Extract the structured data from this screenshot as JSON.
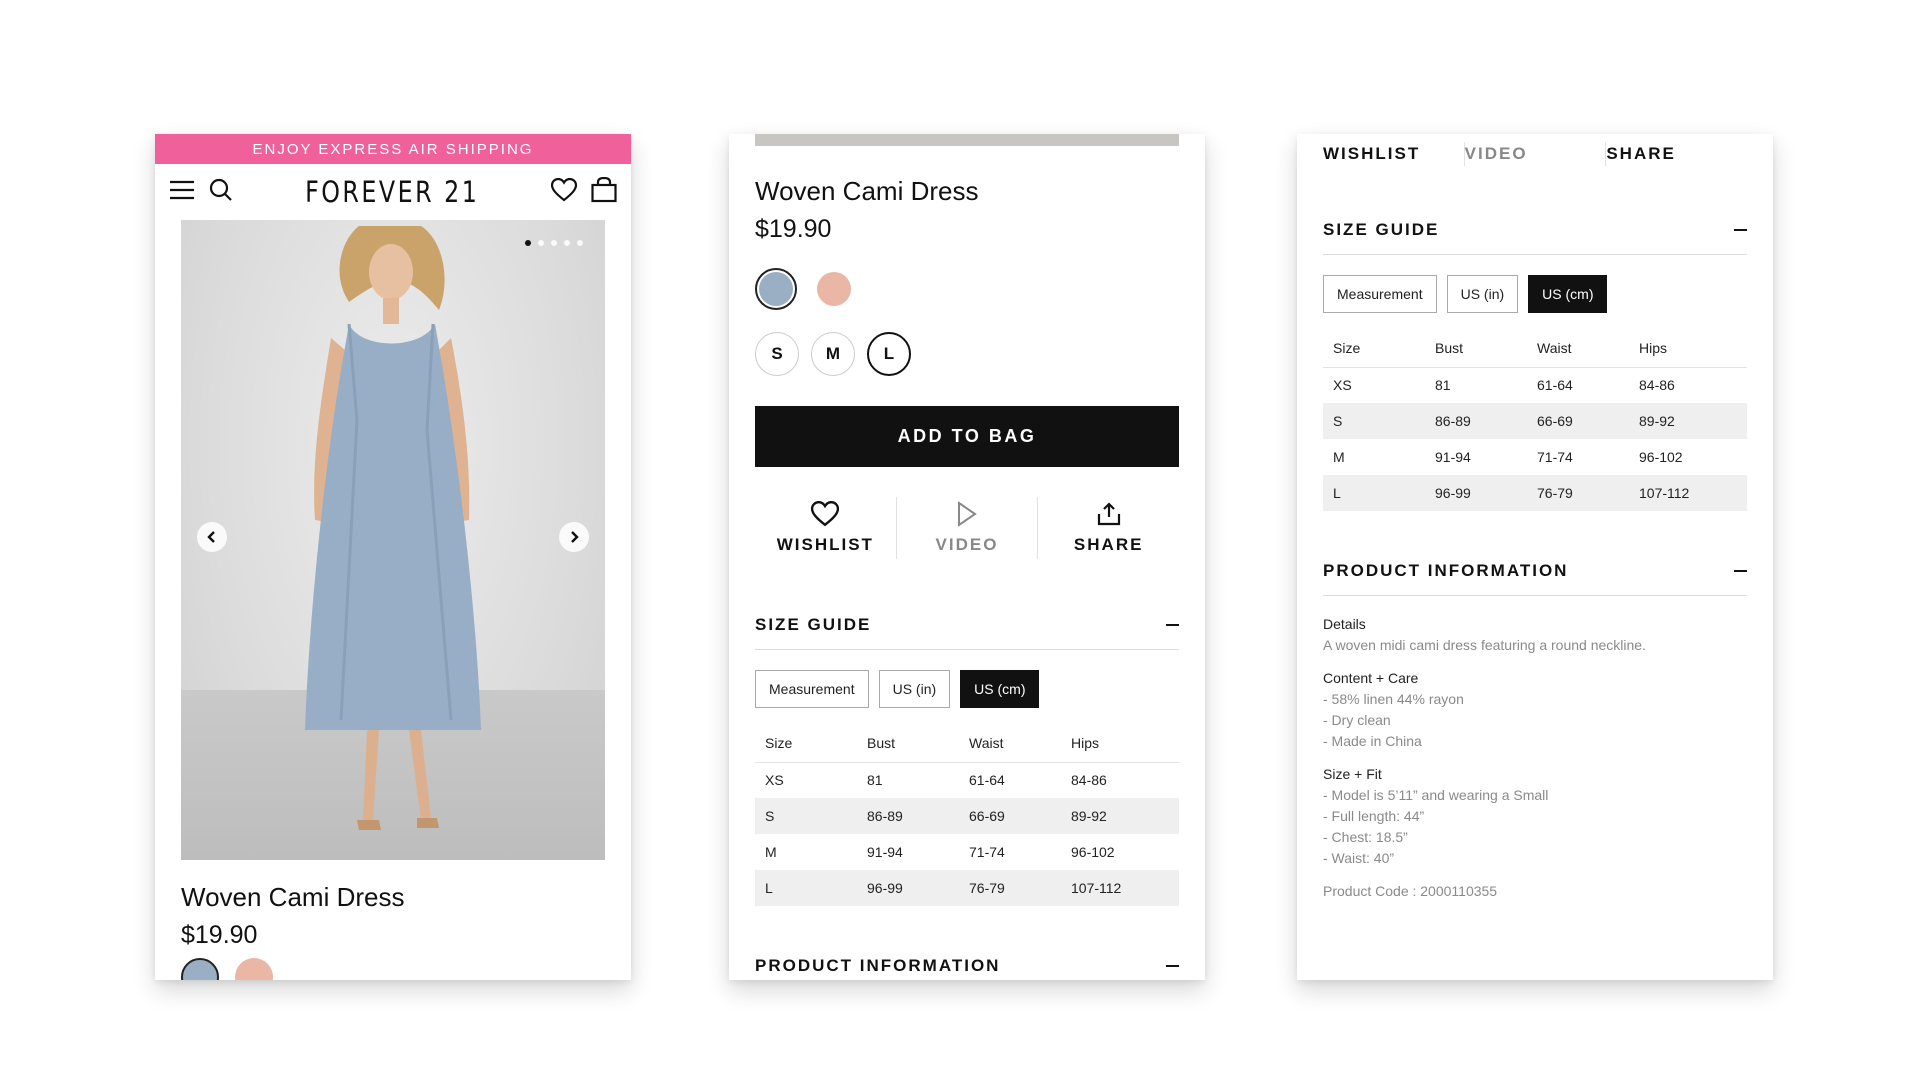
{
  "promo": "ENJOY EXPRESS AIR SHIPPING",
  "brand": "FOREVER 21",
  "product": {
    "name": "Woven Cami Dress",
    "price": "$19.90"
  },
  "colors": [
    "#9aaec4",
    "#eab6a6"
  ],
  "sizes": [
    "S",
    "M",
    "L"
  ],
  "add_to_bag": "ADD TO BAG",
  "actions": {
    "wishlist": "WISHLIST",
    "video": "VIDEO",
    "share": "SHARE"
  },
  "size_guide": {
    "title": "SIZE GUIDE",
    "tabs": [
      "Measurement",
      "US (in)",
      "US (cm)"
    ],
    "headers": [
      "Size",
      "Bust",
      "Waist",
      "Hips"
    ],
    "rows": [
      [
        "XS",
        "81",
        "61-64",
        "84-86"
      ],
      [
        "S",
        "86-89",
        "66-69",
        "89-92"
      ],
      [
        "M",
        "91-94",
        "71-74",
        "96-102"
      ],
      [
        "L",
        "96-99",
        "76-79",
        "107-112"
      ]
    ]
  },
  "product_info": {
    "title": "PRODUCT INFORMATION",
    "details_label": "Details",
    "details_text": "A woven midi cami dress featuring a round neckline.",
    "care_label": "Content + Care",
    "care_items": [
      "- 58% linen 44% rayon",
      "- Dry clean",
      "- Made in China"
    ],
    "fit_label": "Size + Fit",
    "fit_items": [
      "- Model is 5’11” and wearing a Small",
      "- Full length: 44”",
      "- Chest: 18.5”",
      "- Waist: 40”"
    ],
    "product_code": "Product Code : 2000110355"
  }
}
